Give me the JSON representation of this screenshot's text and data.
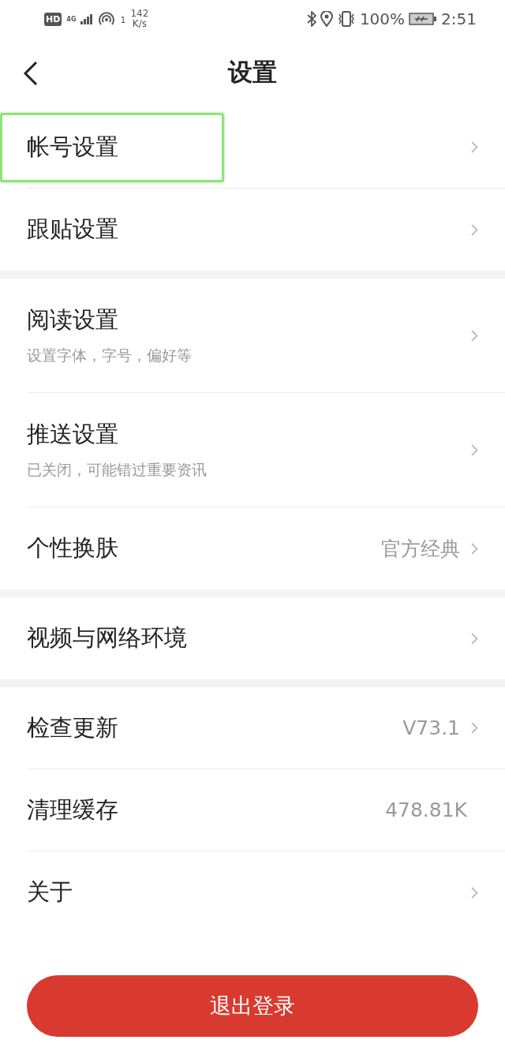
{
  "status_bar": {
    "hd": "HD",
    "network": "4G",
    "hotspot_count": "1",
    "speed": "142",
    "speed_unit": "K/s",
    "battery": "100%",
    "time": "2:51"
  },
  "header": {
    "title": "设置"
  },
  "groups": [
    {
      "items": [
        {
          "title": "帐号设置",
          "chevron": true,
          "highlighted": true
        },
        {
          "title": "跟贴设置",
          "chevron": true,
          "highlighted": false
        }
      ]
    },
    {
      "items": [
        {
          "title": "阅读设置",
          "subtitle": "设置字体，字号，偏好等",
          "chevron": true,
          "highlighted": false
        },
        {
          "title": "推送设置",
          "subtitle": "已关闭，可能错过重要资讯",
          "chevron": true,
          "highlighted": false
        },
        {
          "title": "个性换肤",
          "value": "官方经典",
          "chevron": true,
          "highlighted": false
        }
      ]
    },
    {
      "items": [
        {
          "title": "视频与网络环境",
          "chevron": true,
          "highlighted": false
        }
      ]
    },
    {
      "items": [
        {
          "title": "检查更新",
          "value": "V73.1",
          "chevron": true,
          "highlighted": false
        },
        {
          "title": "清理缓存",
          "value": "478.81K",
          "chevron": false,
          "highlighted": false
        },
        {
          "title": "关于",
          "chevron": true,
          "highlighted": false
        }
      ]
    }
  ],
  "logout_button": {
    "label": "退出登录"
  }
}
